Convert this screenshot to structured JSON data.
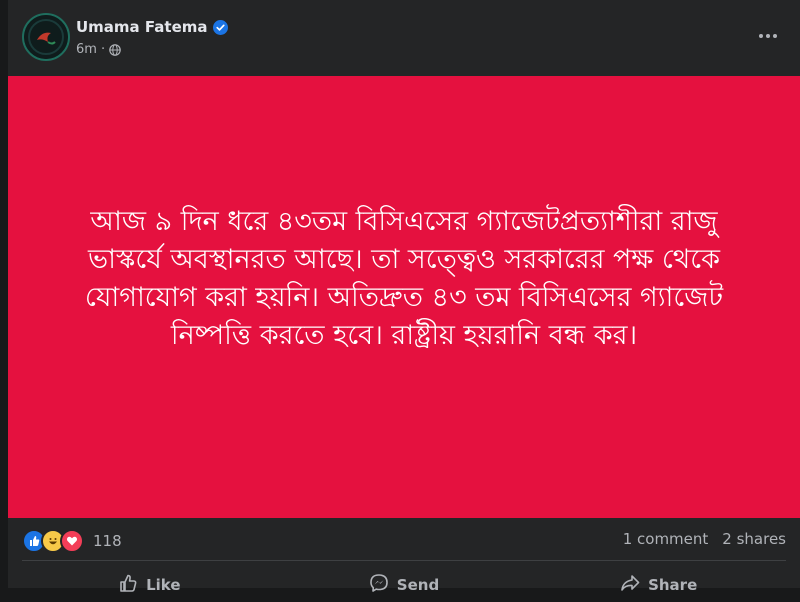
{
  "post": {
    "author": "Umama Fatema",
    "time": "6m",
    "text": "আজ ৯ দিন ধরে ৪৩তম বিসিএসের গ্যাজেটপ্রত্যাশীরা রাজু ভাস্কর্যে অবস্থানরত আছে। তা সত্ত্বেও সরকারের পক্ষ থেকে যোগাযোগ করা হয়নি। অতিদ্রুত ৪৩ তম বিসিএসের গ্যাজেট নিষ্পত্তি করতে হবে। রাষ্ট্রীয় হয়রানি বন্ধ কর।",
    "background_color": "#e5113f"
  },
  "stats": {
    "reaction_count": "118",
    "comments": "1 comment",
    "shares": "2 shares"
  },
  "actions": {
    "like": "Like",
    "comment": "Send",
    "share": "Share"
  },
  "icons": [
    "verified-badge-icon",
    "globe-icon",
    "more-options-icon",
    "like-reaction-icon",
    "haha-reaction-icon",
    "love-reaction-icon",
    "thumbs-up-icon",
    "messenger-icon",
    "share-icon"
  ]
}
